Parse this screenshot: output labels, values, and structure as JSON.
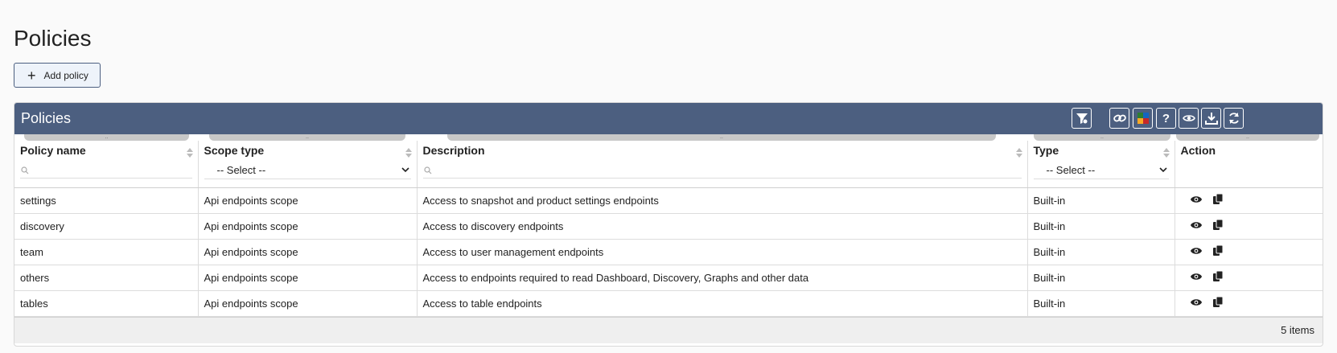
{
  "page": {
    "title": "Policies",
    "add_button_label": "Add policy"
  },
  "panel": {
    "title": "Policies",
    "toolbar": [
      "filter-settings-icon",
      "link-icon",
      "color-grid-icon",
      "help-icon",
      "eye-icon",
      "download-icon",
      "refresh-icon"
    ]
  },
  "columns": {
    "policy_name": "Policy name",
    "scope_type": "Scope type",
    "description": "Description",
    "type": "Type",
    "action": "Action"
  },
  "filters": {
    "scope_type_select": "-- Select --",
    "type_select": "-- Select --"
  },
  "rows": [
    {
      "name": "settings",
      "scope": "Api endpoints scope",
      "description": "Access to snapshot and product settings endpoints",
      "type": "Built-in"
    },
    {
      "name": "discovery",
      "scope": "Api endpoints scope",
      "description": "Access to discovery endpoints",
      "type": "Built-in"
    },
    {
      "name": "team",
      "scope": "Api endpoints scope",
      "description": "Access to user management endpoints",
      "type": "Built-in"
    },
    {
      "name": "others",
      "scope": "Api endpoints scope",
      "description": "Access to endpoints required to read Dashboard, Discovery, Graphs and other data",
      "type": "Built-in"
    },
    {
      "name": "tables",
      "scope": "Api endpoints scope",
      "description": "Access to table endpoints",
      "type": "Built-in"
    }
  ],
  "footer": {
    "count": "5 items"
  },
  "colors": {
    "header_bg": "#4c5f80",
    "accent": "#4c5f80"
  }
}
